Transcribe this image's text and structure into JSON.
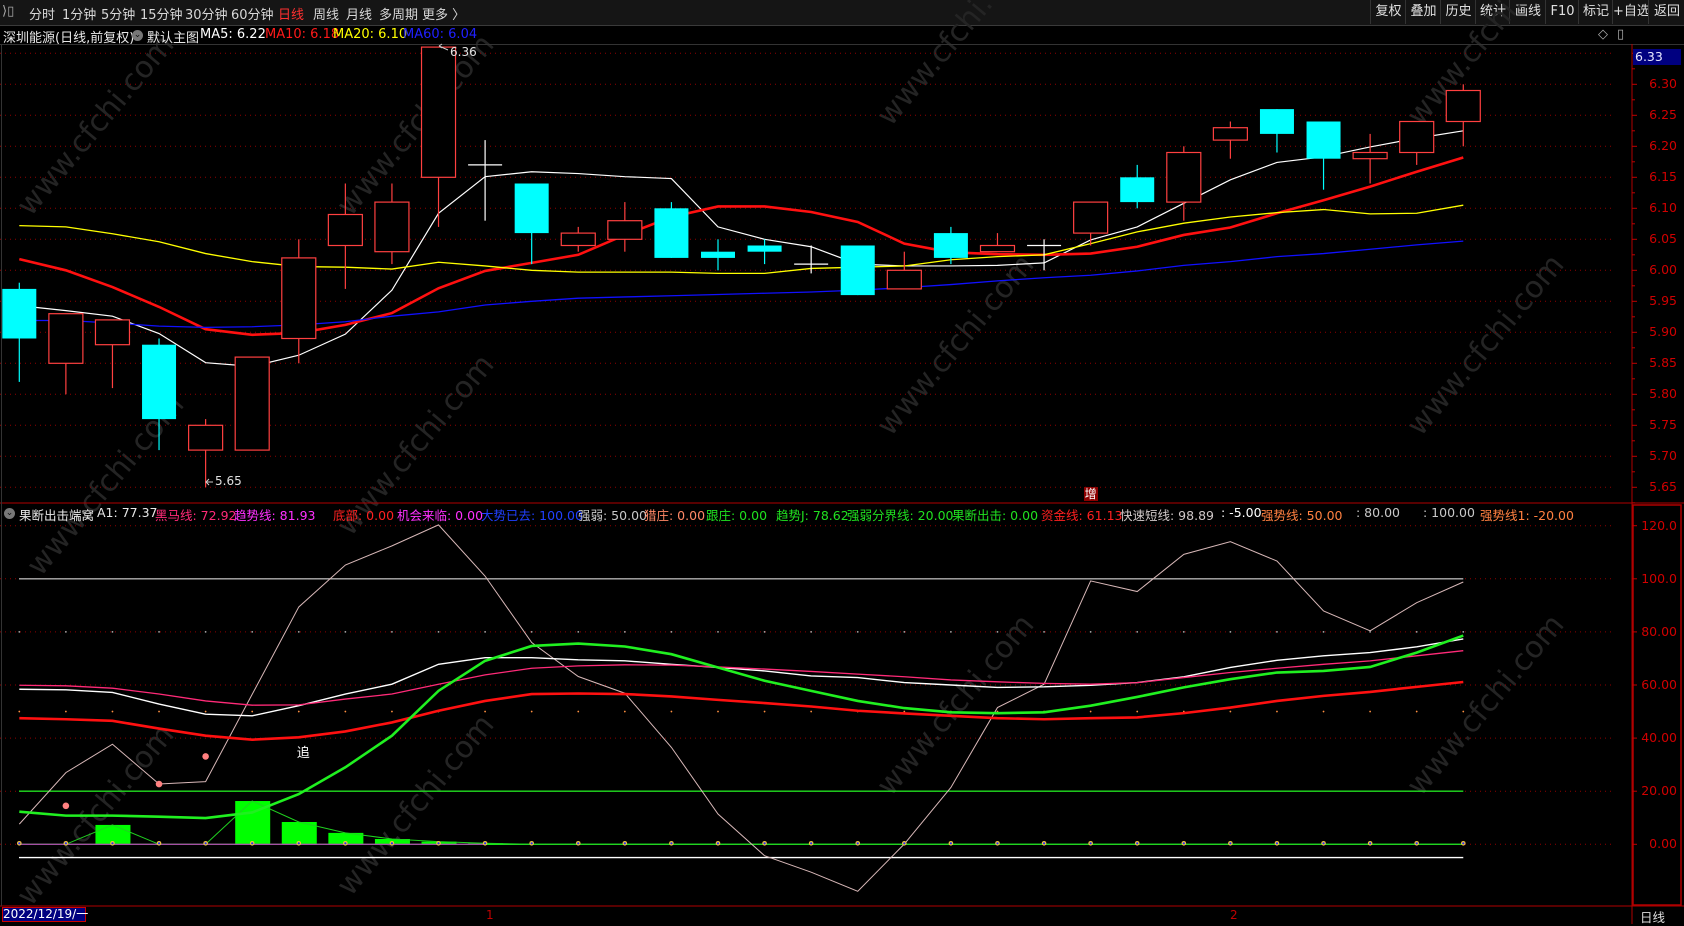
{
  "toolbar": {
    "left_items": [
      "分时",
      "1分钟",
      "5分钟",
      "15分钟",
      "30分钟",
      "60分钟",
      "日线",
      "周线",
      "月线",
      "多周期",
      "更多 〉"
    ],
    "active_item": "日线",
    "right_buttons": [
      "复权",
      "叠加",
      "历史",
      "统计",
      "画线",
      "F10",
      "标记",
      "+自选",
      "返回"
    ]
  },
  "infobar": {
    "stock_title": "深圳能源(日线,前复权)",
    "template": "默认主图",
    "ma5": "MA5: 6.22",
    "ma10": "MA10: 6.18",
    "ma20": "MA20: 6.10",
    "ma60": "MA60: 6.04",
    "diamond_icon": "◇",
    "panel_icon": "▯"
  },
  "indicator_header": {
    "name": "果断出击端窝",
    "items": [
      {
        "text": "A1: 77.37",
        "color": "#e8e8e8"
      },
      {
        "text": "黑马线: 72.92",
        "color": "#ff2a78"
      },
      {
        "text": "趋势线: 81.93",
        "color": "#ff30ff"
      },
      {
        "text": "底部: 0.00",
        "color": "#ff2020"
      },
      {
        "text": "机会来临: 0.00",
        "color": "#ff30ff"
      },
      {
        "text": "大势已去: 100.00",
        "color": "#2040ff"
      },
      {
        "text": "强弱: 50.00",
        "color": "#c8c8c8"
      },
      {
        "text": "猎庄: 0.00",
        "color": "#ff8866"
      },
      {
        "text": "跟庄: 0.00",
        "color": "#20e020"
      },
      {
        "text": "趋势J: 78.62",
        "color": "#20e020"
      },
      {
        "text": "强弱分界线: 20.00",
        "color": "#20e020"
      },
      {
        "text": "果断出击: 0.00",
        "color": "#20e020"
      },
      {
        "text": "资金线: 61.13",
        "color": "#ff2020"
      },
      {
        "text": "快速短线: 98.89",
        "color": "#d0c8c8"
      },
      {
        "text": ": -5.00",
        "color": "#ffffff"
      },
      {
        "text": "强势线: 50.00",
        "color": "#ff8040"
      },
      {
        "text": ": 80.00",
        "color": "#c8c8c8"
      },
      {
        "text": ": 100.00",
        "color": "#c8c8c8"
      },
      {
        "text": "强势线1: -20.00",
        "color": "#ff8040"
      }
    ]
  },
  "bottom_axis": {
    "date": "2022/12/19/一",
    "month_labels": [
      "1",
      "2"
    ],
    "period": "日线"
  },
  "watermark": "www.cfchi.com",
  "colors": {
    "up": "#ff4040",
    "down": "#00ffff",
    "doji": "#ffffff",
    "ma5": "#ffffff",
    "ma10": "#ff1010",
    "ma20": "#ffff00",
    "ma60": "#1010ff",
    "axis": "#c00000"
  },
  "chart_data": [
    {
      "type": "candlestick",
      "title": "深圳能源(日线,前复权)",
      "ylim": [
        5.63,
        6.37
      ],
      "yticks": [
        "6.30",
        "6.25",
        "6.20",
        "6.15",
        "6.10",
        "6.05",
        "6.00",
        "5.95",
        "5.90",
        "5.85",
        "5.80",
        "5.75",
        "5.70",
        "5.65"
      ],
      "last_price_label": "6.33",
      "high_label": "6.36",
      "low_label": "5.65",
      "signal_label": "增",
      "signal_index": 23,
      "candles_ohlc": [
        [
          5.97,
          5.98,
          5.82,
          5.89
        ],
        [
          5.85,
          5.93,
          5.8,
          5.93
        ],
        [
          5.88,
          5.92,
          5.81,
          5.92
        ],
        [
          5.88,
          5.89,
          5.71,
          5.76
        ],
        [
          5.71,
          5.76,
          5.65,
          5.75
        ],
        [
          5.71,
          5.86,
          5.71,
          5.86
        ],
        [
          5.89,
          6.05,
          5.85,
          6.02
        ],
        [
          6.04,
          6.14,
          5.97,
          6.09
        ],
        [
          6.03,
          6.14,
          6.01,
          6.11
        ],
        [
          6.15,
          6.36,
          6.07,
          6.36
        ],
        [
          6.17,
          6.21,
          6.08,
          6.17
        ],
        [
          6.14,
          6.14,
          6.01,
          6.06
        ],
        [
          6.04,
          6.07,
          6.03,
          6.06
        ],
        [
          6.05,
          6.11,
          6.03,
          6.08
        ],
        [
          6.1,
          6.11,
          6.02,
          6.02
        ],
        [
          6.03,
          6.05,
          6.0,
          6.02
        ],
        [
          6.04,
          6.05,
          6.01,
          6.03
        ],
        [
          6.01,
          6.04,
          5.995,
          6.01
        ],
        [
          6.04,
          6.04,
          5.96,
          5.96
        ],
        [
          5.97,
          6.03,
          5.97,
          6.0
        ],
        [
          6.06,
          6.07,
          6.01,
          6.02
        ],
        [
          6.03,
          6.06,
          6.03,
          6.04
        ],
        [
          6.04,
          6.05,
          6.0,
          6.04
        ],
        [
          6.06,
          6.11,
          6.04,
          6.11
        ],
        [
          6.15,
          6.17,
          6.1,
          6.11
        ],
        [
          6.11,
          6.2,
          6.08,
          6.19
        ],
        [
          6.21,
          6.24,
          6.18,
          6.23
        ],
        [
          6.26,
          6.26,
          6.19,
          6.22
        ],
        [
          6.24,
          6.24,
          6.13,
          6.18
        ],
        [
          6.18,
          6.22,
          6.14,
          6.19
        ],
        [
          6.19,
          6.24,
          6.17,
          6.24
        ],
        [
          6.24,
          6.3,
          6.2,
          6.29
        ]
      ],
      "series": [
        {
          "name": "MA5",
          "values": [
            5.943,
            5.935,
            5.926,
            5.898,
            5.851,
            5.845,
            5.863,
            5.897,
            5.968,
            6.092,
            6.151,
            6.159,
            6.156,
            6.151,
            6.148,
            6.07,
            6.05,
            6.038,
            6.01,
            6.007,
            6.007,
            6.008,
            6.012,
            6.049,
            6.07,
            6.108,
            6.146,
            6.174,
            6.183,
            6.199,
            6.213,
            6.225
          ]
        },
        {
          "name": "MA10",
          "values": [
            6.018,
            6.0,
            5.973,
            5.941,
            5.905,
            5.896,
            5.899,
            5.912,
            5.931,
            5.971,
            5.999,
            6.012,
            6.025,
            6.057,
            6.086,
            6.103,
            6.103,
            6.094,
            6.078,
            6.043,
            6.029,
            6.026,
            6.025,
            6.027,
            6.038,
            6.057,
            6.069,
            6.092,
            6.113,
            6.135,
            6.159,
            6.182
          ]
        },
        {
          "name": "MA20",
          "values": [
            6.072,
            6.07,
            6.059,
            6.046,
            6.027,
            6.014,
            6.006,
            6.005,
            6.002,
            6.013,
            6.007,
            6.0,
            5.997,
            5.997,
            5.997,
            5.995,
            5.995,
            6.003,
            6.005,
            6.007,
            6.017,
            6.022,
            6.025,
            6.043,
            6.062,
            6.076,
            6.086,
            6.093,
            6.098,
            6.091,
            6.092,
            6.105
          ]
        },
        {
          "name": "MA60",
          "values": [
            5.919,
            5.919,
            5.915,
            5.91,
            5.908,
            5.909,
            5.912,
            5.917,
            5.926,
            5.933,
            5.944,
            5.95,
            5.955,
            5.957,
            5.959,
            5.961,
            5.963,
            5.965,
            5.968,
            5.972,
            5.977,
            5.983,
            5.988,
            5.992,
            5.999,
            6.008,
            6.014,
            6.022,
            6.027,
            6.034,
            6.041,
            6.047
          ]
        }
      ]
    },
    {
      "type": "line",
      "title": "果断出击端窝",
      "ylim": [
        -10,
        125
      ],
      "yticks": [
        "120.0",
        "100.0",
        "80.00",
        "60.00",
        "40.00",
        "20.00",
        "0.00"
      ],
      "ytick_values": [
        120,
        100,
        80,
        60,
        40,
        20,
        0
      ],
      "reference_lines": [
        {
          "name": "大势已去",
          "value": 100,
          "color": "#b0b0b0"
        },
        {
          "name": "强弱分界线",
          "value": 20,
          "color": "#20e020"
        },
        {
          "name": "果断出击",
          "value": 0,
          "color": "#20e020"
        },
        {
          "name": "-5",
          "value": -5,
          "color": "#ffffff"
        }
      ],
      "chase_label": "追",
      "chase_index": 6,
      "chase_value": 35,
      "series": [
        {
          "name": "快速短线",
          "color": "#d8b8b8",
          "width": 1,
          "values": [
            7.6,
            27,
            37.7,
            22.7,
            23.6,
            56.5,
            89.4,
            105.2,
            112.4,
            120.3,
            101,
            76,
            63.2,
            56.9,
            36.5,
            11.4,
            -4.3,
            -10.5,
            -17.7,
            0.1,
            21.4,
            51.5,
            60.3,
            99.2,
            95.2,
            109.2,
            114,
            106.7,
            87.9,
            80.4,
            91,
            98.8
          ]
        },
        {
          "name": "A1",
          "color": "#ffffff",
          "width": 1.4,
          "values": [
            58.4,
            58.2,
            57.2,
            52.8,
            49,
            48.4,
            52.2,
            56.6,
            60.3,
            67.8,
            70.3,
            70.3,
            69.5,
            69.1,
            67.8,
            66.6,
            65.3,
            63.4,
            62.8,
            60.9,
            60,
            59.1,
            59.3,
            59.9,
            60.9,
            63.1,
            66.6,
            69.3,
            71,
            72.2,
            74.4,
            77.37
          ]
        },
        {
          "name": "黑马线",
          "color": "#ff2a78",
          "width": 1.3,
          "values": [
            59.9,
            59.7,
            58.8,
            56.6,
            54,
            52.4,
            52.5,
            54.7,
            56.6,
            60.3,
            63.8,
            66.3,
            67.2,
            67.6,
            67.5,
            66.8,
            66,
            65.1,
            64.1,
            63.1,
            61.9,
            61.2,
            60.6,
            60.3,
            60.9,
            62.8,
            64.7,
            66.3,
            67.8,
            69.1,
            71,
            72.92
          ]
        },
        {
          "name": "资金线",
          "color": "#ff1010",
          "width": 2.6,
          "values": [
            47.5,
            47.1,
            46.5,
            43.6,
            40.9,
            39.4,
            40.3,
            42.5,
            45.9,
            50.3,
            54,
            56.6,
            56.8,
            56.6,
            55.7,
            54.4,
            53.2,
            51.9,
            50.3,
            49.3,
            48.4,
            47.5,
            47.1,
            47.5,
            47.8,
            49.4,
            51.5,
            54,
            55.9,
            57.4,
            59.3,
            61.13
          ]
        },
        {
          "name": "趋势J",
          "color": "#20f020",
          "width": 2.6,
          "values": [
            12.3,
            10.8,
            10.8,
            10.4,
            9.9,
            12,
            18.9,
            29,
            40.9,
            57.8,
            69.1,
            74.7,
            75.6,
            74.5,
            71.6,
            66.6,
            61.6,
            57.8,
            54,
            51.3,
            49.7,
            49.4,
            49.7,
            52.2,
            55.5,
            59.1,
            62.2,
            64.7,
            65.3,
            66.8,
            72.2,
            78.62
          ]
        }
      ],
      "bars": {
        "name": "果断出击",
        "color": "#00ff00",
        "values": [
          0,
          0,
          7.3,
          0,
          0,
          16.3,
          8.4,
          4.3,
          2.0,
          1.0,
          0.4,
          0,
          0,
          0,
          0,
          0,
          0,
          0,
          0,
          0,
          0,
          0,
          0,
          0,
          0,
          0,
          0,
          0,
          0,
          0,
          0,
          0
        ]
      },
      "dots": {
        "name": "猎庄",
        "color": "#ff8080",
        "points": [
          [
            1,
            14.5
          ],
          [
            3,
            22.7
          ],
          [
            4,
            33.1
          ]
        ]
      }
    }
  ]
}
